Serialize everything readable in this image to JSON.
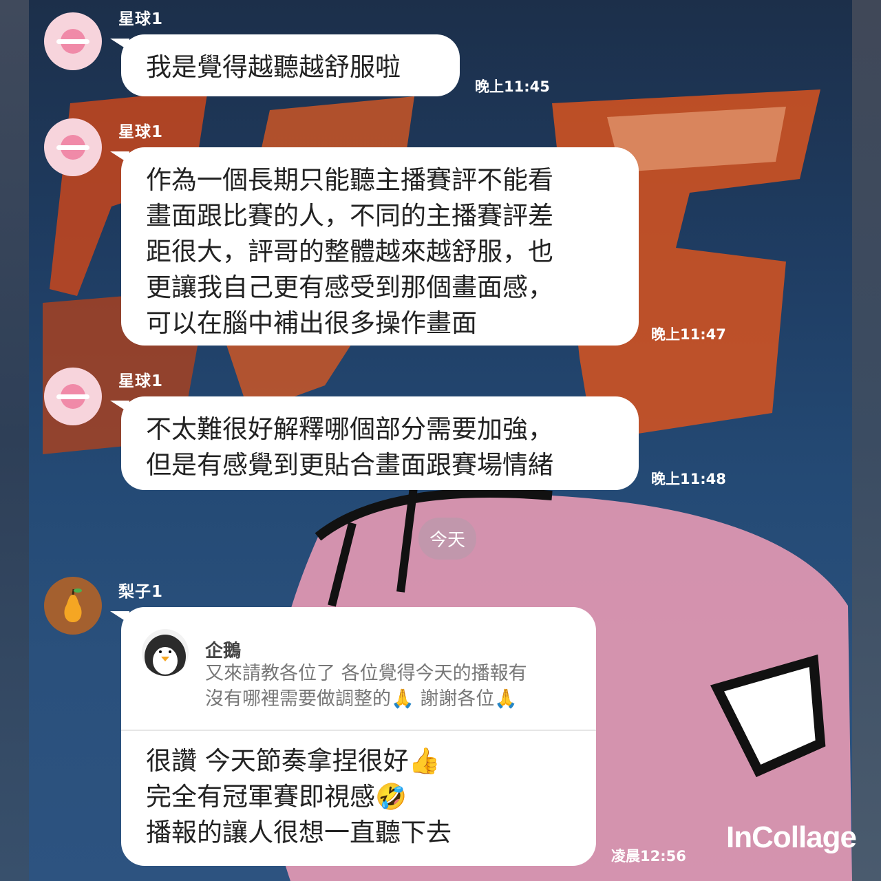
{
  "messages": [
    {
      "sender": "星球1",
      "text": "我是覺得越聽越舒服啦",
      "time": "晚上11:45"
    },
    {
      "sender": "星球1",
      "lines": [
        "作為一個長期只能聽主播賽評不能看",
        "畫面跟比賽的人，不同的主播賽評差",
        "距很大，評哥的整體越來越舒服，也",
        "更讓我自己更有感受到那個畫面感，",
        "可以在腦中補出很多操作畫面"
      ],
      "time": "晚上11:47"
    },
    {
      "sender": "星球1",
      "lines": [
        "不太難很好解釋哪個部分需要加強，",
        "但是有感覺到更貼合畫面跟賽場情緒"
      ],
      "time": "晚上11:48"
    }
  ],
  "date_divider": "今天",
  "reply_message": {
    "sender": "梨子1",
    "quoted_sender": "企鵝",
    "quoted_lines": [
      "又來請教各位了 各位覺得今天的播報有",
      "沒有哪裡需要做調整的🙏 謝謝各位🙏"
    ],
    "lines": [
      "很讚 今天節奏拿捏很好👍",
      "完全有冠軍賽即視感🤣",
      "播報的讓人很想一直聽下去"
    ],
    "time": "凌晨12:56"
  },
  "watermark": "InCollage",
  "icons": {
    "planet_avatar": "planet-icon",
    "pear_avatar": "pear-icon",
    "penguin_avatar": "penguin-icon"
  },
  "colors": {
    "bubble": "#ffffff",
    "planet_avatar_bg": "#f7d4dc",
    "pear_avatar_bg": "#a4602f"
  }
}
